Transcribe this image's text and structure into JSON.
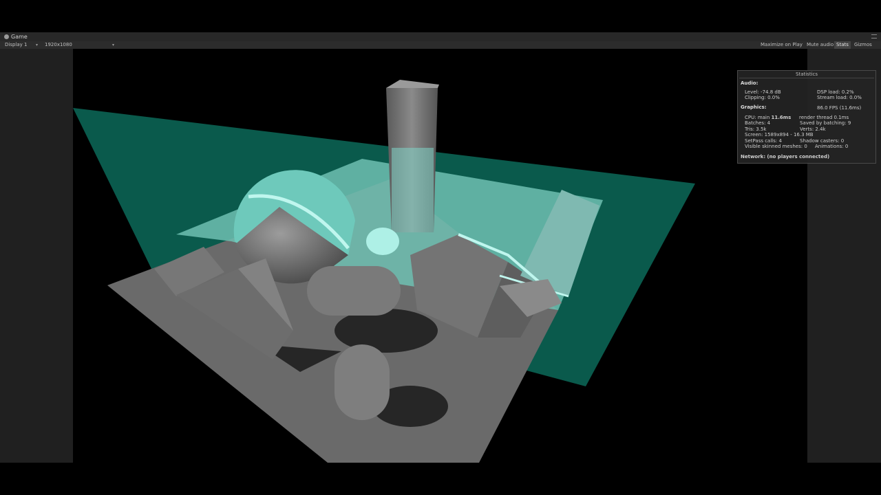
{
  "tab": {
    "title": "Game"
  },
  "toolbar": {
    "display": "Display 1",
    "resolution": "1920x1080",
    "maximize_on_play": "Maximize on Play",
    "mute_audio": "Mute audio",
    "stats": "Stats",
    "gizmos": "Gizmos"
  },
  "stats": {
    "title": "Statistics",
    "audio_heading": "Audio:",
    "level": "Level: -74.8 dB",
    "clipping": "Clipping: 0.0%",
    "dsp_load": "DSP load: 0.2%",
    "stream_load": "Stream load: 0.0%",
    "graphics_heading": "Graphics:",
    "fps": "86.0 FPS (11.6ms)",
    "cpu_prefix": "CPU: main ",
    "cpu_main": "11.6ms",
    "render_thread": "render thread 0.1ms",
    "batches": "Batches: 4",
    "saved_by_batching": "Saved by batching: 9",
    "tris": "Tris: 3.5k",
    "verts": "Verts: 2.4k",
    "screen": "Screen: 1589x894 - 16.3 MB",
    "setpass": "SetPass calls: 4",
    "shadow_casters": "Shadow casters: 0",
    "skinned_meshes": "Visible skinned meshes: 0",
    "animations": "Animations: 0",
    "network_heading": "Network:",
    "network_status": "(no players connected)"
  },
  "colors": {
    "water_plane": "#0a5a4c",
    "water_rim": "#bff6ee",
    "ground": "#6e6e6e",
    "stone": "#7c7c7c"
  }
}
